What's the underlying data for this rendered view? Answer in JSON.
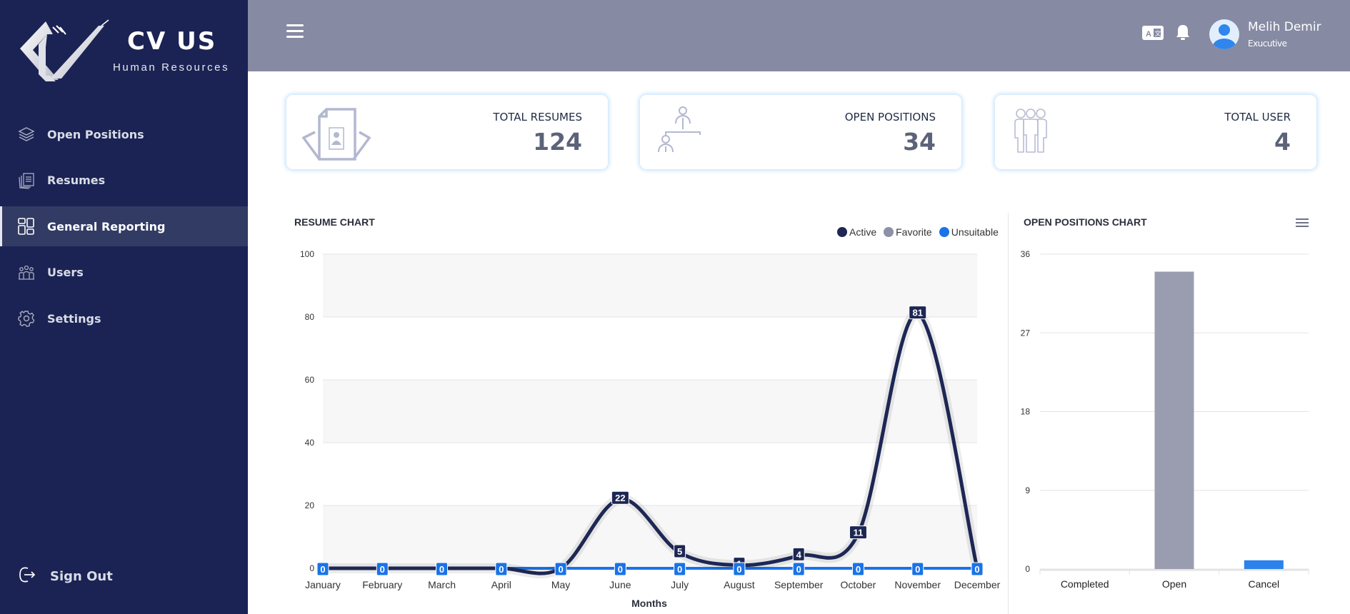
{
  "brand": {
    "name": "CV US",
    "subtitle": "Human Resources"
  },
  "sidebar": {
    "items": [
      {
        "label": "Open Positions",
        "icon": "layers-icon",
        "active": false
      },
      {
        "label": "Resumes",
        "icon": "documents-icon",
        "active": false
      },
      {
        "label": "General Reporting",
        "icon": "dashboard-grid-icon",
        "active": true
      },
      {
        "label": "Users",
        "icon": "users-group-icon",
        "active": false
      },
      {
        "label": "Settings",
        "icon": "gear-icon",
        "active": false
      }
    ],
    "signout_label": "Sign Out"
  },
  "header": {
    "user_name": "Melih Demir",
    "user_role": "Exucutive"
  },
  "stats": [
    {
      "title": "TOTAL RESUMES",
      "value": "124",
      "icon": "resume-icon"
    },
    {
      "title": "OPEN POSITIONS",
      "value": "34",
      "icon": "org-chart-icon"
    },
    {
      "title": "TOTAL USER",
      "value": "4",
      "icon": "users-icon"
    }
  ],
  "colors": {
    "sidebar_bg": "#1a2353",
    "topbar_bg": "#868aa3",
    "active": "#1d2754",
    "favorite": "#8d90a6",
    "unsuitable": "#1a73e8",
    "open_bar": "#9a9db0",
    "cancel_bar": "#2b82ea"
  },
  "chart_data": [
    {
      "type": "line",
      "title": "RESUME CHART",
      "xlabel": "Months",
      "ylabel": "",
      "ylim": [
        0,
        100
      ],
      "yticks": [
        0,
        20,
        40,
        60,
        80,
        100
      ],
      "grid": true,
      "legend": "top-right",
      "categories": [
        "January",
        "February",
        "March",
        "April",
        "May",
        "June",
        "July",
        "August",
        "September",
        "October",
        "November",
        "December"
      ],
      "series": [
        {
          "name": "Active",
          "color": "#1d2754",
          "values": [
            0,
            0,
            0,
            0,
            0,
            22,
            5,
            1,
            4,
            11,
            81,
            0
          ]
        },
        {
          "name": "Favorite",
          "color": "#8d90a6",
          "values": [
            0,
            0,
            0,
            0,
            0,
            0,
            0,
            0,
            0,
            0,
            0,
            0
          ]
        },
        {
          "name": "Unsuitable",
          "color": "#1a73e8",
          "values": [
            0,
            0,
            0,
            0,
            0,
            0,
            0,
            0,
            0,
            0,
            0,
            0
          ]
        }
      ]
    },
    {
      "type": "bar",
      "title": "OPEN POSITIONS CHART",
      "xlabel": "",
      "ylabel": "",
      "ylim": [
        0,
        36
      ],
      "yticks": [
        0,
        9,
        18,
        27,
        36
      ],
      "grid": true,
      "categories": [
        "Completed",
        "Open",
        "Cancel"
      ],
      "values": [
        0,
        34,
        1
      ],
      "colors": [
        "#9a9db0",
        "#9a9db0",
        "#2b82ea"
      ]
    }
  ]
}
